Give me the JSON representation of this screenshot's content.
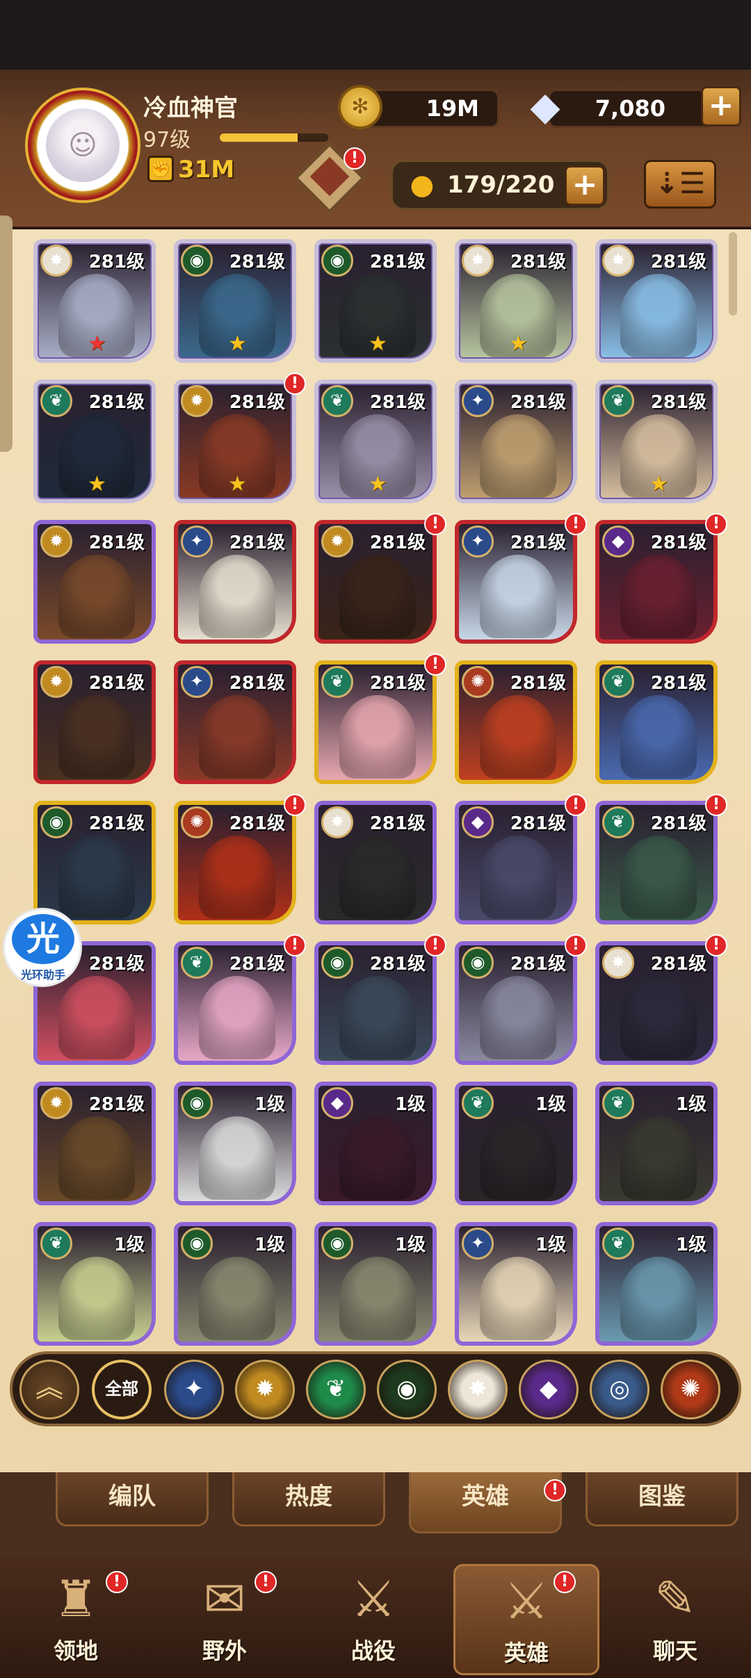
{
  "header": {
    "player_name": "冷血神官",
    "player_level": "97级",
    "xp_fraction": 0.72,
    "power": "31M",
    "gold": "19M",
    "diamonds": "7,080",
    "roster": "179/220"
  },
  "heroes": [
    {
      "level": "281级",
      "faction": "celestial",
      "border": "silver",
      "star": "★",
      "star_color": "#e33",
      "alert": false,
      "tint": "#aab0c8"
    },
    {
      "level": "281级",
      "faction": "wilder",
      "border": "silver",
      "star": "★",
      "star_color": "#f6c21e",
      "alert": false,
      "tint": "#3a6a8e"
    },
    {
      "level": "281级",
      "faction": "wilder",
      "border": "silver",
      "star": "★",
      "star_color": "#f6c21e",
      "alert": false,
      "tint": "#2a3030"
    },
    {
      "level": "281级",
      "faction": "celestial",
      "border": "silver",
      "star": "★",
      "star_color": "#f6c21e",
      "alert": false,
      "tint": "#b8c6a0"
    },
    {
      "level": "281级",
      "faction": "celestial",
      "border": "silver",
      "star": "",
      "star_color": "#f6c21e",
      "alert": false,
      "tint": "#8ac0e8"
    },
    {
      "level": "281级",
      "faction": "graveborn",
      "border": "silver",
      "star": "★",
      "star_color": "#f6c21e",
      "alert": false,
      "tint": "#1e2a3a"
    },
    {
      "level": "281级",
      "faction": "mauler",
      "border": "silver",
      "star": "★",
      "star_color": "#f6c21e",
      "alert": true,
      "tint": "#8a3a24"
    },
    {
      "level": "281级",
      "faction": "graveborn",
      "border": "silver",
      "star": "★",
      "star_color": "#f6c21e",
      "alert": false,
      "tint": "#9a90a8"
    },
    {
      "level": "281级",
      "faction": "lightbearer",
      "border": "silver",
      "star": "",
      "star_color": "#f6c21e",
      "alert": false,
      "tint": "#c0a070"
    },
    {
      "level": "281级",
      "faction": "graveborn",
      "border": "silver",
      "star": "★",
      "star_color": "#f6c21e",
      "alert": false,
      "tint": "#d8c0a0"
    },
    {
      "level": "281级",
      "faction": "mauler",
      "border": "purple",
      "star": "",
      "star_color": "#f6c21e",
      "alert": false,
      "tint": "#7a4a2a"
    },
    {
      "level": "281级",
      "faction": "lightbearer",
      "border": "red",
      "star": "",
      "star_color": "#f6c21e",
      "alert": false,
      "tint": "#e8e0d0"
    },
    {
      "level": "281级",
      "faction": "mauler",
      "border": "red",
      "star": "",
      "star_color": "#f6c21e",
      "alert": true,
      "tint": "#3a2418"
    },
    {
      "level": "281级",
      "faction": "lightbearer",
      "border": "red",
      "star": "",
      "star_color": "#f6c21e",
      "alert": true,
      "tint": "#c8d8e8"
    },
    {
      "level": "281级",
      "faction": "hypogean",
      "border": "red",
      "star": "",
      "star_color": "#f6c21e",
      "alert": true,
      "tint": "#6a2030"
    },
    {
      "level": "281级",
      "faction": "mauler",
      "border": "red",
      "star": "",
      "star_color": "#f6c21e",
      "alert": false,
      "tint": "#4a3020"
    },
    {
      "level": "281级",
      "faction": "lightbearer",
      "border": "red",
      "star": "",
      "star_color": "#f6c21e",
      "alert": false,
      "tint": "#8a3a28"
    },
    {
      "level": "281级",
      "faction": "graveborn",
      "border": "gold",
      "star": "",
      "star_color": "#f6c21e",
      "alert": true,
      "tint": "#e8a8b0"
    },
    {
      "level": "281级",
      "faction": "dimensional",
      "border": "gold",
      "star": "",
      "star_color": "#f6c21e",
      "alert": false,
      "tint": "#c04020"
    },
    {
      "level": "281级",
      "faction": "graveborn",
      "border": "gold",
      "star": "",
      "star_color": "#f6c21e",
      "alert": false,
      "tint": "#4a6ab0"
    },
    {
      "level": "281级",
      "faction": "wilder",
      "border": "gold",
      "star": "",
      "star_color": "#f6c21e",
      "alert": false,
      "tint": "#2a3a4a"
    },
    {
      "level": "281级",
      "faction": "dimensional",
      "border": "gold",
      "star": "",
      "star_color": "#f6c21e",
      "alert": true,
      "tint": "#b03018"
    },
    {
      "level": "281级",
      "faction": "celestial",
      "border": "purple",
      "star": "",
      "star_color": "#f6c21e",
      "alert": false,
      "tint": "#2a2a2a"
    },
    {
      "level": "281级",
      "faction": "hypogean",
      "border": "purple",
      "star": "",
      "star_color": "#f6c21e",
      "alert": true,
      "tint": "#4a4a6a"
    },
    {
      "level": "281级",
      "faction": "graveborn",
      "border": "purple",
      "star": "",
      "star_color": "#f6c21e",
      "alert": true,
      "tint": "#3a5a4a"
    },
    {
      "level": "281级",
      "faction": "mauler",
      "border": "purple",
      "star": "",
      "star_color": "#f6c21e",
      "alert": false,
      "tint": "#d05060"
    },
    {
      "level": "281级",
      "faction": "graveborn",
      "border": "purple",
      "star": "",
      "star_color": "#f6c21e",
      "alert": true,
      "tint": "#e8a8c8"
    },
    {
      "level": "281级",
      "faction": "wilder",
      "border": "purple",
      "star": "",
      "star_color": "#f6c21e",
      "alert": true,
      "tint": "#3a4a5a"
    },
    {
      "level": "281级",
      "faction": "wilder",
      "border": "purple",
      "star": "",
      "star_color": "#f6c21e",
      "alert": true,
      "tint": "#8a8aa0"
    },
    {
      "level": "281级",
      "faction": "celestial",
      "border": "purple",
      "star": "",
      "star_color": "#f6c21e",
      "alert": true,
      "tint": "#2a2a3a"
    },
    {
      "level": "281级",
      "faction": "mauler",
      "border": "purple",
      "star": "",
      "star_color": "#f6c21e",
      "alert": false,
      "tint": "#6a4a28"
    },
    {
      "level": "1级",
      "faction": "wilder",
      "border": "purple",
      "star": "",
      "star_color": "#f6c21e",
      "alert": false,
      "tint": "#dcdcdc"
    },
    {
      "level": "1级",
      "faction": "hypogean",
      "border": "purple",
      "star": "",
      "star_color": "#f6c21e",
      "alert": false,
      "tint": "#3a1a2a"
    },
    {
      "level": "1级",
      "faction": "graveborn",
      "border": "purple",
      "star": "",
      "star_color": "#f6c21e",
      "alert": false,
      "tint": "#2a2428"
    },
    {
      "level": "1级",
      "faction": "graveborn",
      "border": "purple",
      "star": "",
      "star_color": "#f6c21e",
      "alert": false,
      "tint": "#3a3a30"
    },
    {
      "level": "1级",
      "faction": "graveborn",
      "border": "purple",
      "star": "",
      "star_color": "#f6c21e",
      "alert": false,
      "tint": "#c8d090"
    },
    {
      "level": "1级",
      "faction": "wilder",
      "border": "purple",
      "star": "",
      "star_color": "#f6c21e",
      "alert": false,
      "tint": "#8a8a70"
    },
    {
      "level": "1级",
      "faction": "wilder",
      "border": "purple",
      "star": "",
      "star_color": "#f6c21e",
      "alert": false,
      "tint": "#8a8a70"
    },
    {
      "level": "1级",
      "faction": "lightbearer",
      "border": "purple",
      "star": "",
      "star_color": "#f6c21e",
      "alert": false,
      "tint": "#e8d8b8"
    },
    {
      "level": "1级",
      "faction": "graveborn",
      "border": "purple",
      "star": "",
      "star_color": "#f6c21e",
      "alert": false,
      "tint": "#6a9ab0"
    }
  ],
  "faction_colors": {
    "lightbearer": "#2a4a8a",
    "mauler": "#c08a20",
    "wilder": "#1e5a2a",
    "graveborn": "#1e7a5a",
    "celestial": "#e8e0d0",
    "hypogean": "#5a2a8a",
    "dimensional": "#a83a20"
  },
  "faction_filter": {
    "all_label": "全部",
    "buttons": [
      {
        "name": "lightbearer",
        "icon": "✦",
        "color": "#2a4a8a"
      },
      {
        "name": "mauler",
        "icon": "✹",
        "color": "#c08a20"
      },
      {
        "name": "wilder",
        "icon": "❦",
        "color": "#1e8a4a"
      },
      {
        "name": "graveborn",
        "icon": "◉",
        "color": "#1e3a1e"
      },
      {
        "name": "celestial",
        "icon": "✸",
        "color": "#eee6d8"
      },
      {
        "name": "hypogean",
        "icon": "◆",
        "color": "#5a2a8a"
      },
      {
        "name": "dimensional",
        "icon": "◎",
        "color": "#3a5a8a"
      },
      {
        "name": "dimensional-fire",
        "icon": "✺",
        "color": "#b03a18"
      }
    ]
  },
  "subtabs": [
    "编队",
    "热度",
    "英雄",
    "图鉴"
  ],
  "nav": [
    "领地",
    "野外",
    "战役",
    "英雄",
    "聊天"
  ],
  "side_helper": {
    "glyph": "光",
    "label": "光环助手"
  }
}
